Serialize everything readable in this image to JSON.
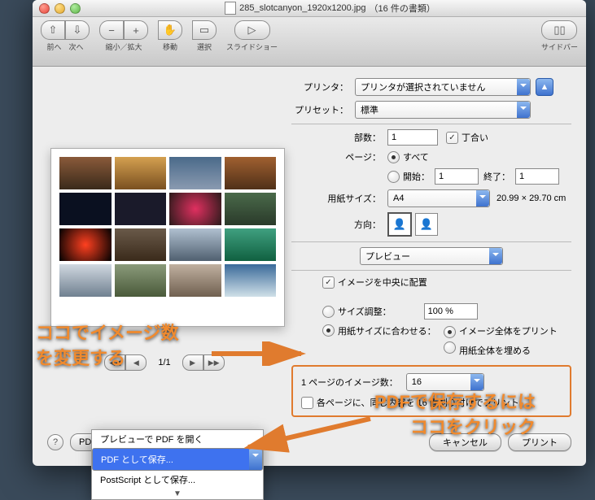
{
  "titlebar": {
    "filename": "285_slotcanyon_1920x1200.jpg",
    "doc_count": "（16 件の書類）"
  },
  "toolbar": {
    "back_fwd": "前へ　次へ",
    "zoom": "縮小／拡大",
    "move": "移動",
    "select": "選択",
    "slideshow": "スライドショー",
    "sidebar": "サイドバー"
  },
  "print": {
    "printer_lbl": "プリンタ：",
    "printer_val": "プリンタが選択されていません",
    "preset_lbl": "プリセット：",
    "preset_val": "標準",
    "copies_lbl": "部数：",
    "copies_val": "1",
    "collate": "丁合い",
    "pages_lbl": "ページ：",
    "pages_all": "すべて",
    "pages_range": "開始：",
    "from_val": "1",
    "to_lbl": "終了：",
    "to_val": "1",
    "paper_lbl": "用紙サイズ：",
    "paper_val": "A4",
    "paper_dim": "20.99 × 29.70 cm",
    "orient_lbl": "方向：",
    "section_sel": "プレビュー",
    "center": "イメージを中央に配置",
    "size_adj": "サイズ調整：",
    "size_pct": "100 %",
    "fit_paper": "用紙サイズに合わせる：",
    "fit_whole": "イメージ全体をプリント",
    "fit_fill": "用紙全体を埋める",
    "per_page_lbl": "1 ページのイメージ数：",
    "per_page_val": "16",
    "same_content": "各ページに、同じ内容を 16 面割り付けでプリント"
  },
  "nav": {
    "page": "1/1"
  },
  "footer": {
    "pdf": "PDF",
    "cancel": "キャンセル",
    "print": "プリント"
  },
  "pdf_menu": {
    "i0": "プレビューで PDF を開く",
    "i1": "PDF として保存...",
    "i2": "PostScript として保存..."
  },
  "anno": {
    "a1": "ココでイメージ数\nを変更する",
    "a2": "PDFで保存するには\nココをクリック"
  }
}
